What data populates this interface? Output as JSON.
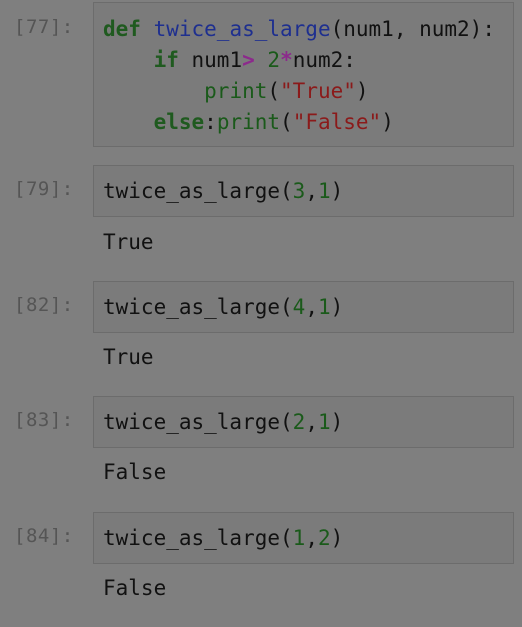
{
  "cells": [
    {
      "prompt": "[77]:",
      "code": [
        {
          "tokens": [
            {
              "t": "def",
              "c": "kw"
            },
            {
              "t": " ",
              "c": ""
            },
            {
              "t": "twice_as_large",
              "c": "fn"
            },
            {
              "t": "(num1, num2):",
              "c": ""
            }
          ]
        },
        {
          "tokens": [
            {
              "t": "    ",
              "c": ""
            },
            {
              "t": "if",
              "c": "kw"
            },
            {
              "t": " num1",
              "c": ""
            },
            {
              "t": ">",
              "c": "op"
            },
            {
              "t": " ",
              "c": ""
            },
            {
              "t": "2",
              "c": "num"
            },
            {
              "t": "*",
              "c": "op"
            },
            {
              "t": "num2:",
              "c": ""
            }
          ]
        },
        {
          "tokens": [
            {
              "t": "        ",
              "c": ""
            },
            {
              "t": "print",
              "c": "num"
            },
            {
              "t": "(",
              "c": ""
            },
            {
              "t": "\"True\"",
              "c": "str"
            },
            {
              "t": ")",
              "c": ""
            }
          ]
        },
        {
          "tokens": [
            {
              "t": "    ",
              "c": ""
            },
            {
              "t": "else",
              "c": "kw"
            },
            {
              "t": ":",
              "c": ""
            },
            {
              "t": "print",
              "c": "num"
            },
            {
              "t": "(",
              "c": ""
            },
            {
              "t": "\"False\"",
              "c": "str"
            },
            {
              "t": ")",
              "c": ""
            }
          ]
        }
      ],
      "output": ""
    },
    {
      "prompt": "[79]:",
      "code": [
        {
          "tokens": [
            {
              "t": "twice_as_large(",
              "c": ""
            },
            {
              "t": "3",
              "c": "num"
            },
            {
              "t": ",",
              "c": ""
            },
            {
              "t": "1",
              "c": "num"
            },
            {
              "t": ")",
              "c": ""
            }
          ]
        }
      ],
      "output": "True"
    },
    {
      "prompt": "[82]:",
      "code": [
        {
          "tokens": [
            {
              "t": "twice_as_large(",
              "c": ""
            },
            {
              "t": "4",
              "c": "num"
            },
            {
              "t": ",",
              "c": ""
            },
            {
              "t": "1",
              "c": "num"
            },
            {
              "t": ")",
              "c": ""
            }
          ]
        }
      ],
      "output": "True"
    },
    {
      "prompt": "[83]:",
      "code": [
        {
          "tokens": [
            {
              "t": "twice_as_large(",
              "c": ""
            },
            {
              "t": "2",
              "c": "num"
            },
            {
              "t": ",",
              "c": ""
            },
            {
              "t": "1",
              "c": "num"
            },
            {
              "t": ")",
              "c": ""
            }
          ]
        }
      ],
      "output": "False"
    },
    {
      "prompt": "[84]:",
      "code": [
        {
          "tokens": [
            {
              "t": "twice_as_large(",
              "c": ""
            },
            {
              "t": "1",
              "c": "num"
            },
            {
              "t": ",",
              "c": ""
            },
            {
              "t": "2",
              "c": "num"
            },
            {
              "t": ")",
              "c": ""
            }
          ]
        }
      ],
      "output": "False"
    }
  ]
}
